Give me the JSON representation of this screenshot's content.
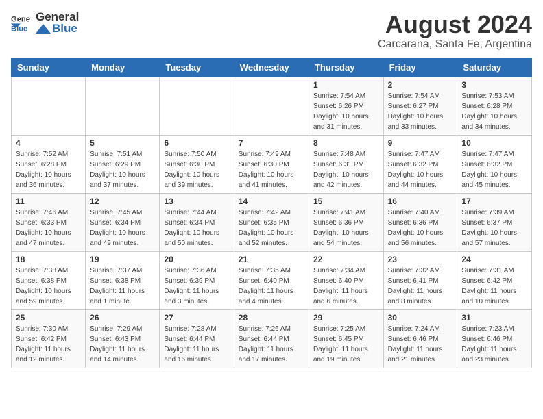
{
  "header": {
    "logo_general": "General",
    "logo_blue": "Blue",
    "title": "August 2024",
    "subtitle": "Carcarana, Santa Fe, Argentina"
  },
  "calendar": {
    "days_of_week": [
      "Sunday",
      "Monday",
      "Tuesday",
      "Wednesday",
      "Thursday",
      "Friday",
      "Saturday"
    ],
    "weeks": [
      [
        {
          "day": "",
          "info": ""
        },
        {
          "day": "",
          "info": ""
        },
        {
          "day": "",
          "info": ""
        },
        {
          "day": "",
          "info": ""
        },
        {
          "day": "1",
          "info": "Sunrise: 7:54 AM\nSunset: 6:26 PM\nDaylight: 10 hours\nand 31 minutes."
        },
        {
          "day": "2",
          "info": "Sunrise: 7:54 AM\nSunset: 6:27 PM\nDaylight: 10 hours\nand 33 minutes."
        },
        {
          "day": "3",
          "info": "Sunrise: 7:53 AM\nSunset: 6:28 PM\nDaylight: 10 hours\nand 34 minutes."
        }
      ],
      [
        {
          "day": "4",
          "info": "Sunrise: 7:52 AM\nSunset: 6:28 PM\nDaylight: 10 hours\nand 36 minutes."
        },
        {
          "day": "5",
          "info": "Sunrise: 7:51 AM\nSunset: 6:29 PM\nDaylight: 10 hours\nand 37 minutes."
        },
        {
          "day": "6",
          "info": "Sunrise: 7:50 AM\nSunset: 6:30 PM\nDaylight: 10 hours\nand 39 minutes."
        },
        {
          "day": "7",
          "info": "Sunrise: 7:49 AM\nSunset: 6:30 PM\nDaylight: 10 hours\nand 41 minutes."
        },
        {
          "day": "8",
          "info": "Sunrise: 7:48 AM\nSunset: 6:31 PM\nDaylight: 10 hours\nand 42 minutes."
        },
        {
          "day": "9",
          "info": "Sunrise: 7:47 AM\nSunset: 6:32 PM\nDaylight: 10 hours\nand 44 minutes."
        },
        {
          "day": "10",
          "info": "Sunrise: 7:47 AM\nSunset: 6:32 PM\nDaylight: 10 hours\nand 45 minutes."
        }
      ],
      [
        {
          "day": "11",
          "info": "Sunrise: 7:46 AM\nSunset: 6:33 PM\nDaylight: 10 hours\nand 47 minutes."
        },
        {
          "day": "12",
          "info": "Sunrise: 7:45 AM\nSunset: 6:34 PM\nDaylight: 10 hours\nand 49 minutes."
        },
        {
          "day": "13",
          "info": "Sunrise: 7:44 AM\nSunset: 6:34 PM\nDaylight: 10 hours\nand 50 minutes."
        },
        {
          "day": "14",
          "info": "Sunrise: 7:42 AM\nSunset: 6:35 PM\nDaylight: 10 hours\nand 52 minutes."
        },
        {
          "day": "15",
          "info": "Sunrise: 7:41 AM\nSunset: 6:36 PM\nDaylight: 10 hours\nand 54 minutes."
        },
        {
          "day": "16",
          "info": "Sunrise: 7:40 AM\nSunset: 6:36 PM\nDaylight: 10 hours\nand 56 minutes."
        },
        {
          "day": "17",
          "info": "Sunrise: 7:39 AM\nSunset: 6:37 PM\nDaylight: 10 hours\nand 57 minutes."
        }
      ],
      [
        {
          "day": "18",
          "info": "Sunrise: 7:38 AM\nSunset: 6:38 PM\nDaylight: 10 hours\nand 59 minutes."
        },
        {
          "day": "19",
          "info": "Sunrise: 7:37 AM\nSunset: 6:38 PM\nDaylight: 11 hours\nand 1 minute."
        },
        {
          "day": "20",
          "info": "Sunrise: 7:36 AM\nSunset: 6:39 PM\nDaylight: 11 hours\nand 3 minutes."
        },
        {
          "day": "21",
          "info": "Sunrise: 7:35 AM\nSunset: 6:40 PM\nDaylight: 11 hours\nand 4 minutes."
        },
        {
          "day": "22",
          "info": "Sunrise: 7:34 AM\nSunset: 6:40 PM\nDaylight: 11 hours\nand 6 minutes."
        },
        {
          "day": "23",
          "info": "Sunrise: 7:32 AM\nSunset: 6:41 PM\nDaylight: 11 hours\nand 8 minutes."
        },
        {
          "day": "24",
          "info": "Sunrise: 7:31 AM\nSunset: 6:42 PM\nDaylight: 11 hours\nand 10 minutes."
        }
      ],
      [
        {
          "day": "25",
          "info": "Sunrise: 7:30 AM\nSunset: 6:42 PM\nDaylight: 11 hours\nand 12 minutes."
        },
        {
          "day": "26",
          "info": "Sunrise: 7:29 AM\nSunset: 6:43 PM\nDaylight: 11 hours\nand 14 minutes."
        },
        {
          "day": "27",
          "info": "Sunrise: 7:28 AM\nSunset: 6:44 PM\nDaylight: 11 hours\nand 16 minutes."
        },
        {
          "day": "28",
          "info": "Sunrise: 7:26 AM\nSunset: 6:44 PM\nDaylight: 11 hours\nand 17 minutes."
        },
        {
          "day": "29",
          "info": "Sunrise: 7:25 AM\nSunset: 6:45 PM\nDaylight: 11 hours\nand 19 minutes."
        },
        {
          "day": "30",
          "info": "Sunrise: 7:24 AM\nSunset: 6:46 PM\nDaylight: 11 hours\nand 21 minutes."
        },
        {
          "day": "31",
          "info": "Sunrise: 7:23 AM\nSunset: 6:46 PM\nDaylight: 11 hours\nand 23 minutes."
        }
      ]
    ]
  }
}
